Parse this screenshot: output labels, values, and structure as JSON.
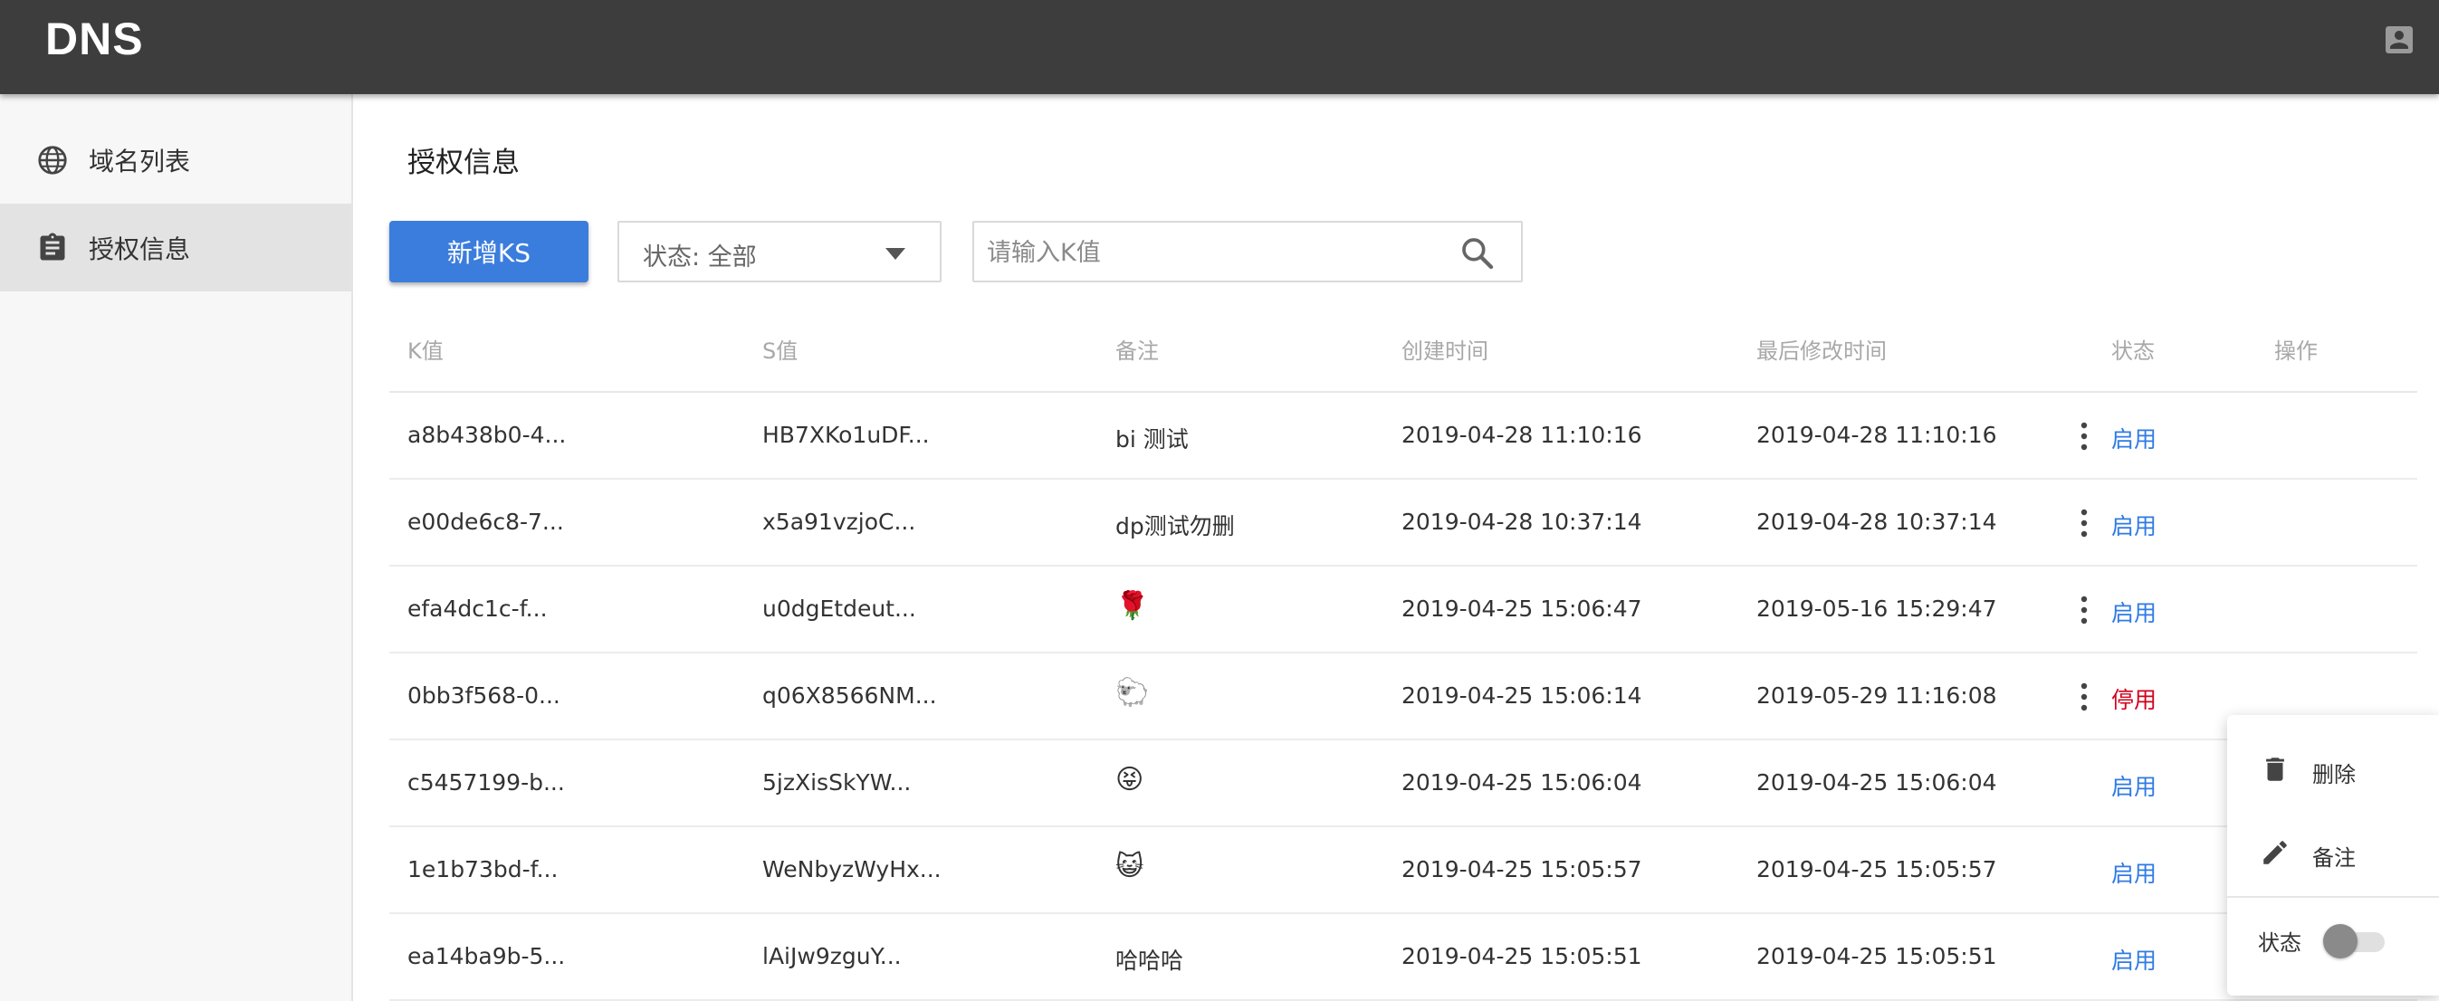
{
  "header": {
    "title": "DNS",
    "account_icon": "account-box-icon"
  },
  "sidebar": {
    "items": [
      {
        "label": "域名列表",
        "icon": "globe-icon",
        "active": false
      },
      {
        "label": "授权信息",
        "icon": "clipboard-icon",
        "active": true
      }
    ]
  },
  "page": {
    "title": "授权信息"
  },
  "toolbar": {
    "add_label": "新增KS",
    "status_filter": {
      "value": "状态: 全部",
      "icon": "caret-down-icon"
    },
    "search": {
      "placeholder": "请输入K值",
      "icon": "search-icon"
    }
  },
  "table": {
    "columns": [
      "K值",
      "S值",
      "备注",
      "创建时间",
      "最后修改时间",
      "状态",
      "操作"
    ],
    "rows": [
      {
        "k": "a8b438b0-4...",
        "s": "HB7XKo1uDF...",
        "note": "bi 测试",
        "created": "2019-04-28 11:10:16",
        "modified": "2019-04-28 11:10:16",
        "status": "启用"
      },
      {
        "k": "e00de6c8-7...",
        "s": "x5a91vzjoC...",
        "note": "dp测试勿删",
        "created": "2019-04-28 10:37:14",
        "modified": "2019-04-28 10:37:14",
        "status": "启用"
      },
      {
        "k": "efa4dc1c-f...",
        "s": "u0dgEtdeut...",
        "note": "🌹",
        "created": "2019-04-25 15:06:47",
        "modified": "2019-05-16 15:29:47",
        "status": "启用"
      },
      {
        "k": "0bb3f568-0...",
        "s": "q06X8566NM...",
        "note": "🐑",
        "created": "2019-04-25 15:06:14",
        "modified": "2019-05-29 11:16:08",
        "status": "停用"
      },
      {
        "k": "c5457199-b...",
        "s": "5jzXisSkYW...",
        "note": "😝",
        "created": "2019-04-25 15:06:04",
        "modified": "2019-04-25 15:06:04",
        "status": "启用"
      },
      {
        "k": "1e1b73bd-f...",
        "s": "WeNbyzWyHx...",
        "note": "😺",
        "created": "2019-04-25 15:05:57",
        "modified": "2019-04-25 15:05:57",
        "status": "启用"
      },
      {
        "k": "ea14ba9b-5...",
        "s": "lAiJw9zguY...",
        "note": "哈哈哈",
        "created": "2019-04-25 15:05:51",
        "modified": "2019-04-25 15:05:51",
        "status": "启用"
      }
    ]
  },
  "row_menu": {
    "delete_label": "删除",
    "delete_icon": "trash-icon",
    "note_label": "备注",
    "note_icon": "pencil-icon",
    "status_label": "状态",
    "status_on": false
  },
  "colors": {
    "primary": "#3b7ddd",
    "enabled": "#2f7be4",
    "disabled": "#d0021b",
    "topbar": "#3d3d3d"
  }
}
